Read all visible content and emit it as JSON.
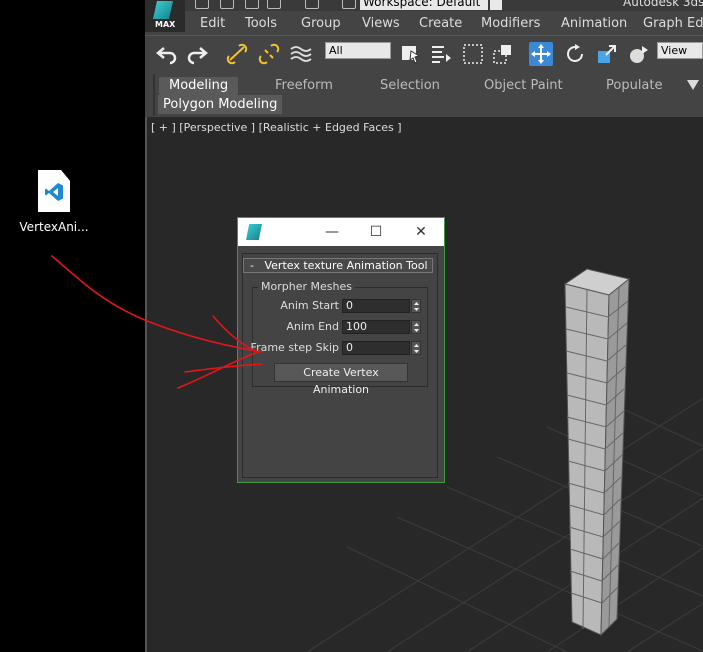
{
  "desktop": {
    "icon_label": "VertexAni..."
  },
  "titlebar": {
    "workspace": "Workspace: Default",
    "app_title": "Autodesk 3ds"
  },
  "logo": {
    "text": "MAX"
  },
  "menu": [
    "Edit",
    "Tools",
    "Group",
    "Views",
    "Create",
    "Modifiers",
    "Animation",
    "Graph Edit"
  ],
  "toolbar": {
    "selection_filter": "All",
    "ref_coord": "View"
  },
  "ribbon": {
    "tabs": [
      "Modeling",
      "Freeform",
      "Selection",
      "Object Paint",
      "Populate"
    ],
    "active_tab": "Modeling",
    "subpanel": "Polygon Modeling"
  },
  "viewport": {
    "label": "[ + ] [Perspective ] [Realistic + Edged Faces ]"
  },
  "dialog": {
    "rollout_title": "Vertex texture Animation Tool",
    "rollout_toggle": "-",
    "group_title": "Morpher Meshes",
    "fields": [
      {
        "label": "Anim Start",
        "value": "0"
      },
      {
        "label": "Anim End",
        "value": "100"
      },
      {
        "label": "Frame step Skip",
        "value": "0"
      }
    ],
    "button": "Create Vertex Animation",
    "minimize": "—",
    "maximize": "☐",
    "close": "✕"
  },
  "colors": {
    "accent": "#3b8ad6",
    "annotation": "#e0161b",
    "dialog_border": "#3f9b3f"
  }
}
